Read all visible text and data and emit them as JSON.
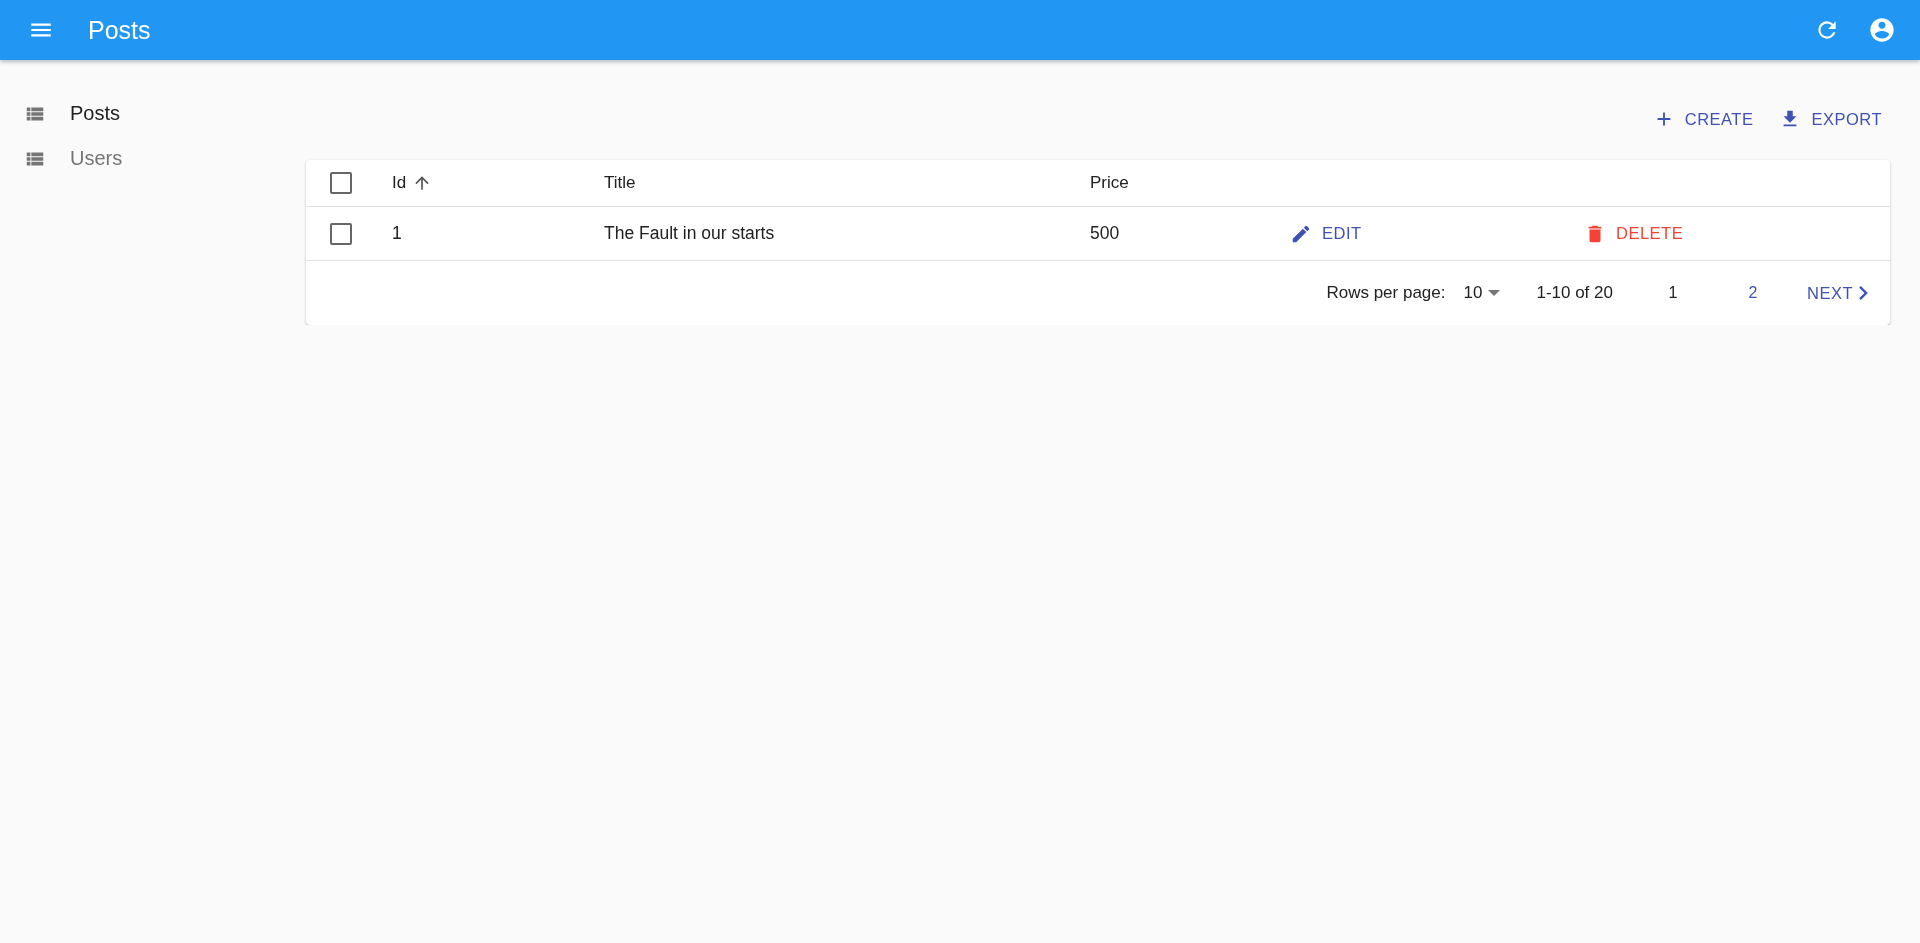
{
  "app_bar": {
    "title": "Posts"
  },
  "sidebar": {
    "items": [
      {
        "label": "Posts",
        "selected": true
      },
      {
        "label": "Users",
        "selected": false
      }
    ]
  },
  "actions": [
    {
      "kind": "create",
      "label": "CREATE"
    },
    {
      "kind": "export",
      "label": "EXPORT"
    }
  ],
  "table": {
    "select_all": {
      "checked": false
    },
    "columns": [
      {
        "label": "Id",
        "sorted": true
      },
      {
        "label": "Title",
        "sorted": false
      },
      {
        "label": "Price",
        "sorted": false
      }
    ],
    "rows": [
      {
        "checked": false,
        "cells": [
          "1",
          "The Fault in our starts",
          "500"
        ],
        "edit": "EDIT",
        "delete": "DELETE"
      }
    ]
  },
  "pagination": {
    "rows_per_page_label": "Rows per page:",
    "rows_per_page": "10",
    "range": "1-10 of 20",
    "pages": [
      {
        "label": "1",
        "selected": true
      },
      {
        "label": "2",
        "selected": false
      }
    ],
    "next": "NEXT"
  }
}
